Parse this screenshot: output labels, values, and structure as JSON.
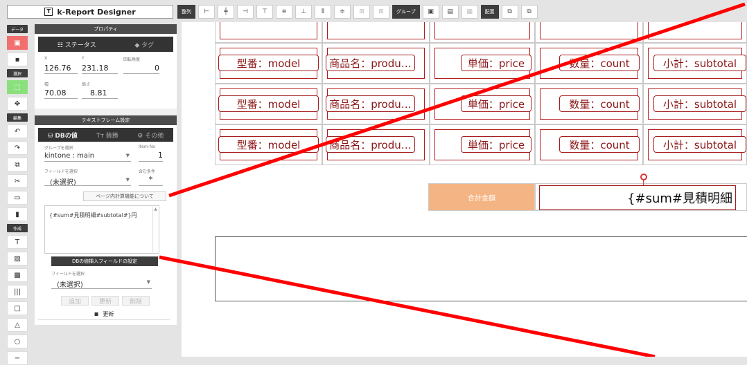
{
  "app": {
    "title": "k-Report Designer"
  },
  "toolbar": {
    "align_label": "整列",
    "group_label": "グループ",
    "arrange_label": "配置"
  },
  "leftcol": {
    "data_label": "データ",
    "select_label": "選択",
    "edit_label": "編集",
    "create_label": "作成"
  },
  "props": {
    "header": "プロパティ",
    "tab_status": "ステータス",
    "tab_tag": "タグ",
    "x_label": "X",
    "x_value": "126.76",
    "y_label": "Y",
    "y_value": "231.18",
    "rot_label": "回転角度",
    "rot_value": "0",
    "w_label": "幅",
    "w_value": "70.08",
    "h_label": "高さ",
    "h_value": "8.81"
  },
  "textframe": {
    "header": "テキストフレーム設定",
    "tab_db": "DBの値",
    "tab_deco": "装飾",
    "tab_other": "その他",
    "group_label": "グループを選択",
    "group_value": "kintone : main",
    "itemno_label": "Item-No",
    "itemno_value": "1",
    "field_label": "フィールドを選択",
    "field_value": "(未選択)",
    "cond_label": "含む条件",
    "cond_value": "*",
    "page_calc_button": "ページ内計算機能について",
    "formula": "{#sum#見積明細#subtotal#}円",
    "db_insert_button": "DBの値挿入フィールドの設定",
    "insert_field_label": "フィールドを選択",
    "insert_field_value": "(未選択)",
    "add_button": "追加",
    "update_button": "更新",
    "delete_button": "削除",
    "save_button": "更新"
  },
  "canvas": {
    "rows": [
      [
        "型番：model",
        "商品名：produ…",
        "単価：price",
        "数量：count",
        "小計：subtotal"
      ],
      [
        "型番：model",
        "商品名：produ…",
        "単価：price",
        "数量：count",
        "小計：subtotal"
      ],
      [
        "型番：model",
        "商品名：produ…",
        "単価：price",
        "数量：count",
        "小計：subtotal"
      ]
    ],
    "total_label": "合計金額",
    "total_value": "{#sum#見積明細"
  },
  "colors": {
    "accent_red": "#a61d1d",
    "total_label_bg": "#f5b483",
    "annotation": "#ff0000"
  }
}
